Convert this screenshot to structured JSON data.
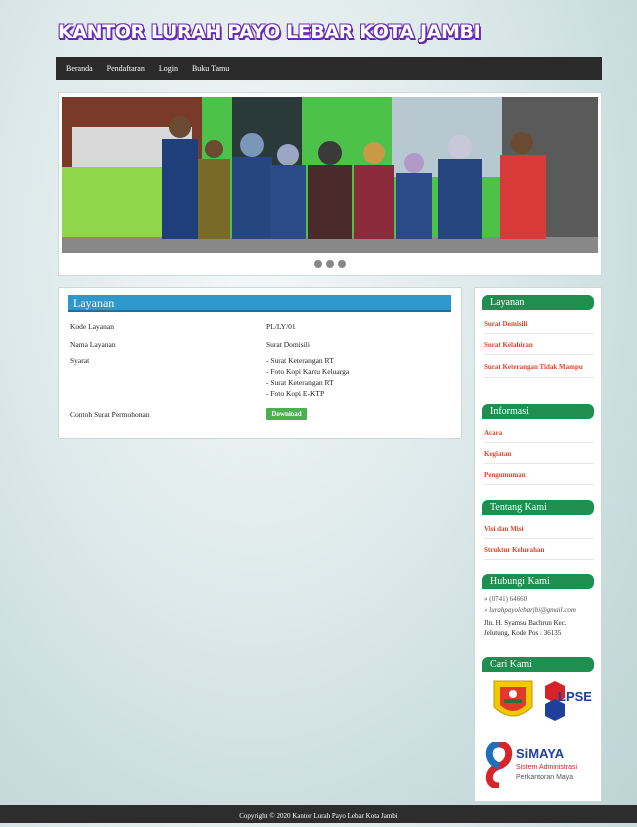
{
  "site": {
    "title": "KANTOR LURAH PAYO LEBAR KOTA JAMBI"
  },
  "nav": {
    "items": [
      "Beranda",
      "Pendaftaran",
      "Login",
      "Buku Tamu"
    ]
  },
  "layanan": {
    "heading": "Layanan",
    "rows": [
      {
        "label": "Kode Layanan",
        "value": "PL/LY/01"
      },
      {
        "label": "Nama Layanan",
        "value": "Surat Domisili"
      },
      {
        "label": "Syarat",
        "value": "- Surat Keterangan RT"
      },
      {
        "label": "",
        "value": "- Foto Kopi Kartu Keluarga"
      },
      {
        "label": "",
        "value": "- Surat Keterangan RT"
      },
      {
        "label": "",
        "value": "- Foto Kopi E-KTP"
      },
      {
        "label": "Contoh Surat Permohonan",
        "value": ""
      }
    ],
    "download_label": "Download"
  },
  "sidebar": {
    "layanan": {
      "title": "Layanan",
      "links": [
        "Surat Domisili",
        "Surat Kelahiran",
        "Surat Keterangan Tidak Mampu"
      ]
    },
    "informasi": {
      "title": "Informasi",
      "links": [
        "Acara",
        "Kegiatan",
        "Pengumuman"
      ]
    },
    "tentang": {
      "title": "Tentang Kami",
      "links": [
        "Visi dan Misi",
        "Struktur Kelurahan"
      ]
    },
    "hubungi": {
      "title": "Hubungi Kami",
      "phone": "» (0741) 64660",
      "email": "» lurahpayolebarjbi@gmail.com",
      "address": "Jln. H. Syamsu Bachrun Kec. Jelutung, Kode Pos : 36135"
    },
    "cari": {
      "title": "Cari Kami",
      "logo1": "LPSE",
      "logo2_title": "SiMAYA",
      "logo2_sub1": "Sistem Administrasi",
      "logo2_sub2": "Perkantoran Maya"
    }
  },
  "footer": {
    "copyright": "Copyright © 2020 Kantor Lurah Payo Lebar Kota Jambi"
  },
  "colors": {
    "accent": "#2e97cc",
    "sidebar_head": "#1f8f4f",
    "link": "#e0432b",
    "nav": "#2a2a2a"
  }
}
